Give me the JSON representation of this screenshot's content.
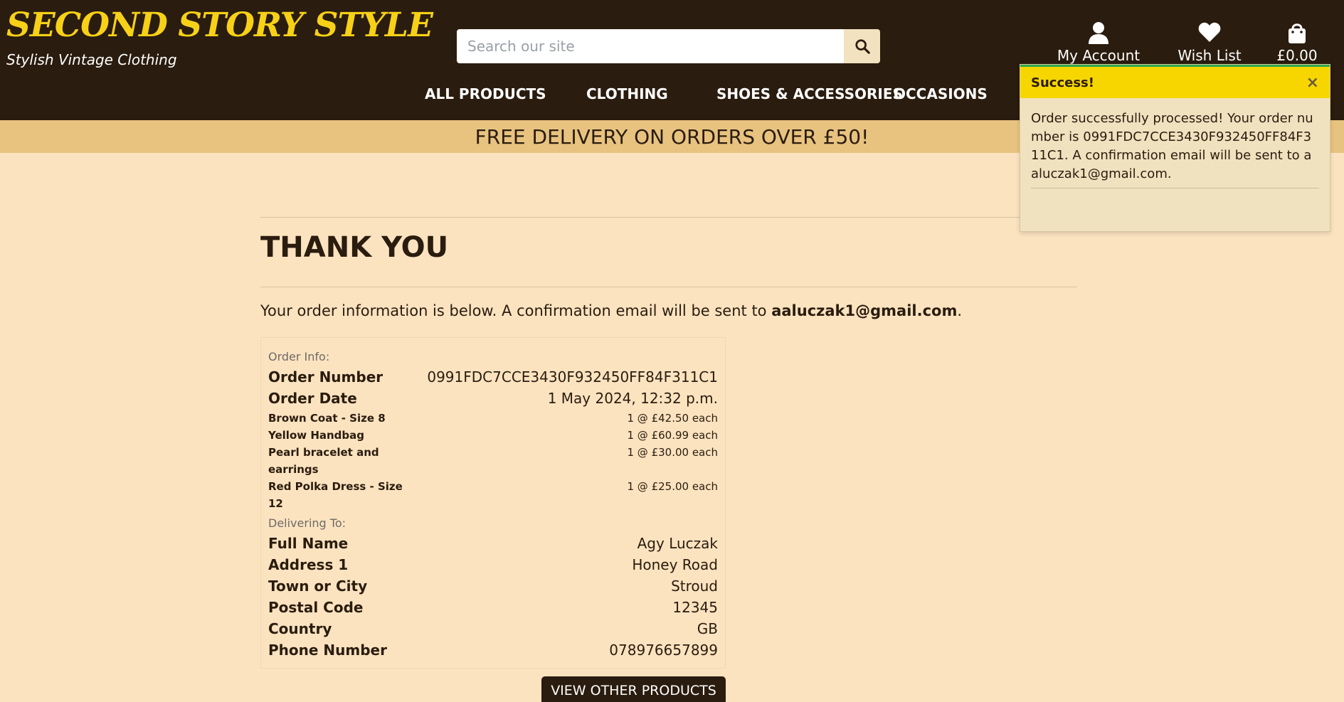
{
  "brand": {
    "title": "SECOND STORY STYLE",
    "tagline": "Stylish Vintage Clothing"
  },
  "search": {
    "placeholder": "Search our site",
    "icon": "search-icon"
  },
  "utility": {
    "account_label": "My Account",
    "wishlist_label": "Wish List",
    "cart_total": "£0.00"
  },
  "nav": {
    "items": [
      "ALL PRODUCTS",
      "CLOTHING",
      "SHOES & ACCESSORIES",
      "OCCASIONS"
    ]
  },
  "banner": {
    "text": "FREE DELIVERY ON ORDERS OVER £50!"
  },
  "toast": {
    "title": "Success!",
    "close": "×",
    "message": "Order successfully processed! Your order number is 0991FDC7CCE3430F932450FF84F311C1. A confirmation email will be sent to aaluczak1@gmail.com."
  },
  "main": {
    "title": "THANK YOU",
    "intro_text": "Your order information is below. A confirmation email will be sent to ",
    "intro_email": "aaluczak1@gmail.com",
    "intro_end": "."
  },
  "order": {
    "info_label": "Order Info:",
    "number_label": "Order Number",
    "number_value": "0991FDC7CCE3430F932450FF84F311C1",
    "date_label": "Order Date",
    "date_value": "1 May 2024, 12:32 p.m.",
    "items": [
      {
        "name": "Brown Coat - Size 8",
        "qty": "1 @ £42.50 each"
      },
      {
        "name": "Yellow Handbag",
        "qty": "1 @ £60.99 each"
      },
      {
        "name": "Pearl bracelet and earrings",
        "qty": "1 @ £30.00 each"
      },
      {
        "name": "Red Polka Dress - Size 12",
        "qty": "1 @ £25.00 each"
      }
    ],
    "delivering_label": "Delivering To:",
    "delivery": [
      {
        "label": "Full Name",
        "value": "Agy Luczak"
      },
      {
        "label": "Address 1",
        "value": "Honey Road"
      },
      {
        "label": "Town or City",
        "value": "Stroud"
      },
      {
        "label": "Postal Code",
        "value": "12345"
      },
      {
        "label": "Country",
        "value": "GB"
      },
      {
        "label": "Phone Number",
        "value": "078976657899"
      }
    ]
  },
  "cta": {
    "label": "VIEW OTHER PRODUCTS"
  },
  "colors": {
    "header_bg": "#2a1c0e",
    "brand_yellow": "#f7d117",
    "page_bg": "#fbe3c0",
    "banner_bg": "#e8c380",
    "toast_head": "#f7d600",
    "success_bar": "#2fa84f"
  }
}
